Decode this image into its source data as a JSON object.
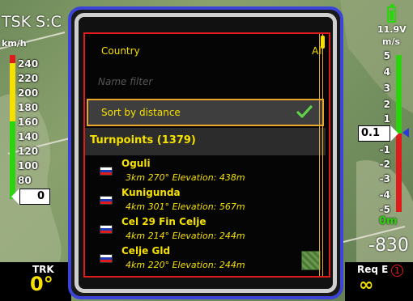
{
  "map": {
    "task_label": "TSK S:C"
  },
  "speed_tape": {
    "unit": "km/h",
    "ticks": [
      "240",
      "220",
      "200",
      "180",
      "160",
      "140",
      "120",
      "100",
      "80"
    ],
    "current": "0"
  },
  "vario_tape": {
    "battery": "11.9V",
    "unit": "m/s",
    "ticks": [
      "5",
      "4",
      "3",
      "2",
      "1",
      "-1",
      "-2",
      "-3",
      "-4",
      "-5"
    ],
    "current": "0.1",
    "zero_label": "0m",
    "altitude": "-830"
  },
  "bottom": {
    "trk_label": "TRK",
    "trk_value": "0°",
    "req_label": "Req E",
    "req_value": "∞",
    "alert_count": "1"
  },
  "dialog": {
    "country_label": "Country",
    "country_value": "All",
    "name_filter_placeholder": "Name filter",
    "sort_label": "Sort by distance",
    "sort_checked": true,
    "section_title": "Turnpoints (1379)",
    "turnpoints": [
      {
        "name": "Oguli",
        "detail": "3km 270° Elevation: 438m",
        "has_thumbnail": false
      },
      {
        "name": "Kunigunda",
        "detail": "4km 301° Elevation: 567m",
        "has_thumbnail": false
      },
      {
        "name": "Cel 29 Fin Celje",
        "detail": "4km 214° Elevation: 244m",
        "has_thumbnail": false
      },
      {
        "name": "Celje Gld",
        "detail": "4km 220° Elevation: 244m",
        "has_thumbnail": true
      }
    ]
  },
  "colors": {
    "accent_yellow": "#f5e000",
    "frame_blue": "#3c44d8",
    "panel_red": "#e01b1b",
    "highlight_orange": "#e8a62a",
    "vario_green": "#2bd40f"
  }
}
